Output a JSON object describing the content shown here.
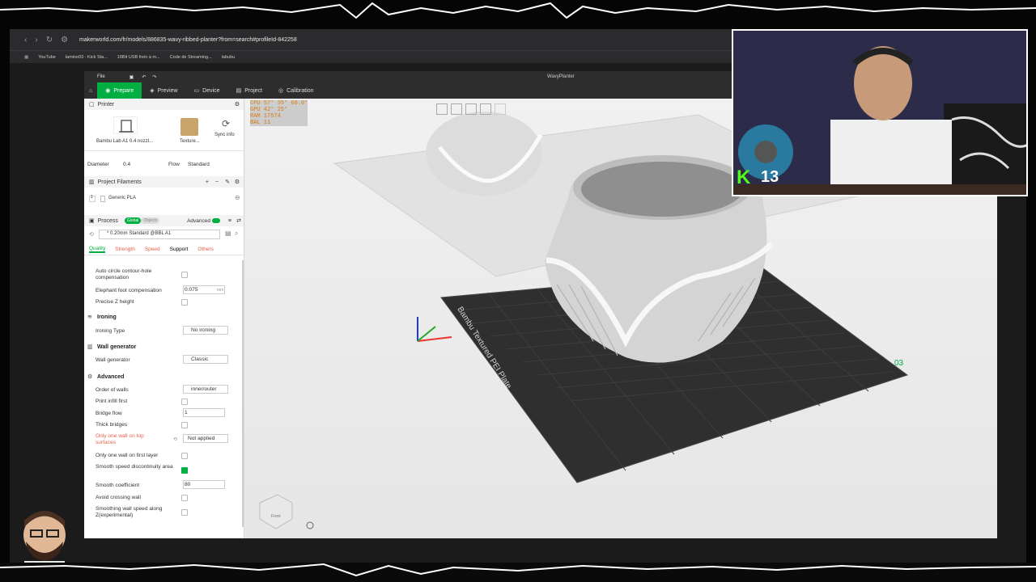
{
  "browser": {
    "url": "makerworld.com/fr/models/886835-wavy-ribbed-planter?from=search#profileId-842258",
    "bookmarks": [
      "YouTube",
      "lamino93 - Kick Sta...",
      "16Bit USB frein à m...",
      "Code de Streaming...",
      "labubu"
    ]
  },
  "studio": {
    "file_menu": "File",
    "window_title": "WavyPlanter",
    "tabs": [
      {
        "label": "Prepare",
        "icon": "prepare-icon"
      },
      {
        "label": "Preview",
        "icon": "preview-icon"
      },
      {
        "label": "Device",
        "icon": "device-icon"
      },
      {
        "label": "Project",
        "icon": "project-icon"
      },
      {
        "label": "Calibration",
        "icon": "calibration-icon"
      }
    ],
    "printer": {
      "section": "Printer",
      "printer_name": "Bambu Lab A1 0.4 nozzl...",
      "plate_name": "Texture...",
      "sync_label": "Sync info",
      "diameter_label": "Diameter",
      "diameter_value": "0.4",
      "flow_label": "Flow",
      "flow_value": "Standard"
    },
    "filaments": {
      "section": "Project Filaments",
      "slot": "1",
      "name": "Generic PLA"
    },
    "process": {
      "section": "Process",
      "global_label": "Global",
      "objects_label": "Objects",
      "advanced_label": "Advanced",
      "preset": "* 0.20mm Standard @BBL A1",
      "tabs": [
        "Quality",
        "Strength",
        "Speed",
        "Support",
        "Others"
      ]
    },
    "settings": {
      "auto_circle_label": "Auto circle contour-hole compensation",
      "elephant_label": "Elephant foot compensation",
      "elephant_value": "0.075",
      "elephant_unit": "mm",
      "precise_z_label": "Precise Z height",
      "ironing_group": "Ironing",
      "ironing_type_label": "Ironing Type",
      "ironing_type_value": "No ironing",
      "wall_gen_group": "Wall generator",
      "wall_gen_label": "Wall generator",
      "wall_gen_value": "Classic",
      "advanced_group": "Advanced",
      "order_walls_label": "Order of walls",
      "order_walls_value": "inner/outer",
      "print_infill_first_label": "Print infill first",
      "bridge_flow_label": "Bridge flow",
      "bridge_flow_value": "1",
      "thick_bridges_label": "Thick bridges",
      "only_one_wall_top_label": "Only one wall on top surfaces",
      "only_one_wall_top_value": "Not applied",
      "only_one_wall_first_label": "Only one wall on first layer",
      "smooth_speed_label": "Smooth speed discontinuity area",
      "smooth_coeff_label": "Smooth coefficient",
      "smooth_coeff_value": "80",
      "avoid_crossing_label": "Avoid crossing wall",
      "smoothing_wall_label": "Smoothing wall speed along Z(experimental)"
    },
    "viewport": {
      "plate_label": "Bambu Textured PEI Plate",
      "plate_number": "03",
      "cube_label": "Front"
    }
  },
  "overlay": {
    "stats": [
      "CPU 57° 35° 60.0°",
      "GPU 42° 25°",
      "RAM 17574",
      "BAL 11"
    ],
    "kick_count": "13"
  },
  "colors": {
    "accent": "#00ae42",
    "warning": "#e4604a",
    "plate": "#2f2f2f"
  }
}
